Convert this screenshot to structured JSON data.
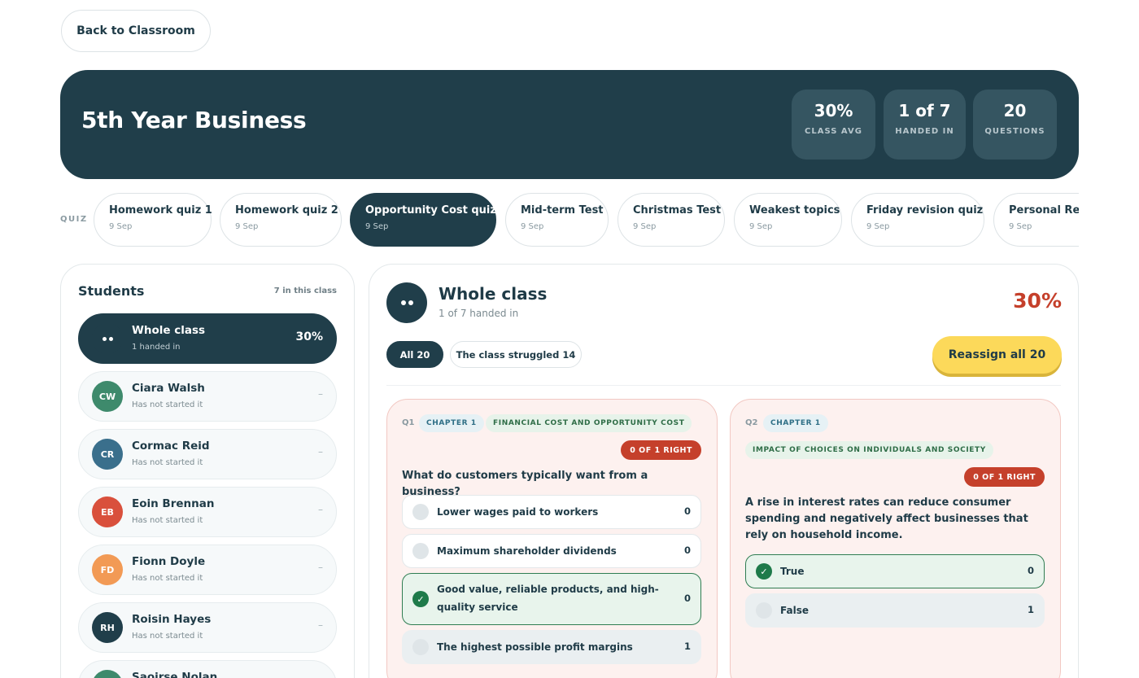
{
  "back_button": "Back to Classroom",
  "hero": {
    "title": "5th Year Business",
    "stats": [
      {
        "value": "30%",
        "label": "CLASS AVG"
      },
      {
        "value": "1 of 7",
        "label": "HANDED IN"
      },
      {
        "value": "20",
        "label": "QUESTIONS"
      }
    ]
  },
  "quiz_label": "QUIZ",
  "quizzes": [
    {
      "name": "Homework quiz 1",
      "date": "9 Sep"
    },
    {
      "name": "Homework quiz 2",
      "date": "9 Sep"
    },
    {
      "name": "Opportunity Cost quiz",
      "date": "9 Sep"
    },
    {
      "name": "Mid-term Test",
      "date": "9 Sep"
    },
    {
      "name": "Christmas Test",
      "date": "9 Sep"
    },
    {
      "name": "Weakest topics",
      "date": "9 Sep"
    },
    {
      "name": "Friday revision quiz",
      "date": "9 Sep"
    },
    {
      "name": "Personal Resa",
      "date": "9 Sep"
    }
  ],
  "students_panel": {
    "title": "Students",
    "count": "7 in this class",
    "whole_class": {
      "name": "Whole class",
      "status": "1 handed in",
      "score": "30%"
    },
    "students": [
      {
        "initials": "CW",
        "name": "Ciara Walsh",
        "status": "Has not started it",
        "score": "–",
        "color": "#3e8a6c"
      },
      {
        "initials": "CR",
        "name": "Cormac Reid",
        "status": "Has not started it",
        "score": "–",
        "color": "#3a6f8c"
      },
      {
        "initials": "EB",
        "name": "Eoin Brennan",
        "status": "Has not started it",
        "score": "–",
        "color": "#d9503c"
      },
      {
        "initials": "FD",
        "name": "Fionn Doyle",
        "status": "Has not started it",
        "score": "–",
        "color": "#f29a55"
      },
      {
        "initials": "RH",
        "name": "Roisin Hayes",
        "status": "Has not started it",
        "score": "–",
        "color": "#203e4a"
      },
      {
        "initials": "SN",
        "name": "Saoirse Nolan",
        "status": "",
        "score": "",
        "color": "#3e8a6c"
      }
    ]
  },
  "main": {
    "title": "Whole class",
    "subtitle": "1 of 7 handed in",
    "score": "30%",
    "filters": [
      "All 20",
      "The class struggled 14"
    ],
    "reassign": "Reassign all 20",
    "questions": [
      {
        "num": "Q1",
        "chapter": "CHAPTER 1",
        "topic": "FINANCIAL COST AND OPPORTUNITY COST",
        "badge": "0 OF 1 RIGHT",
        "text": "What do customers typically want from a business?",
        "options": [
          {
            "text": "Lower wages paid to workers",
            "count": "0"
          },
          {
            "text": "Maximum shareholder dividends",
            "count": "0"
          },
          {
            "text": "Good value, reliable products, and high-quality service",
            "count": "0"
          },
          {
            "text": "The highest possible profit margins",
            "count": "1"
          }
        ]
      },
      {
        "num": "Q2",
        "chapter": "CHAPTER 1",
        "topic": "IMPACT OF CHOICES ON INDIVIDUALS AND SOCIETY",
        "badge": "0 OF 1 RIGHT",
        "text": "A rise in interest rates can reduce consumer spending and negatively affect businesses that rely on household income.",
        "options": [
          {
            "text": "True",
            "count": "0"
          },
          {
            "text": "False",
            "count": "1"
          }
        ]
      }
    ]
  }
}
